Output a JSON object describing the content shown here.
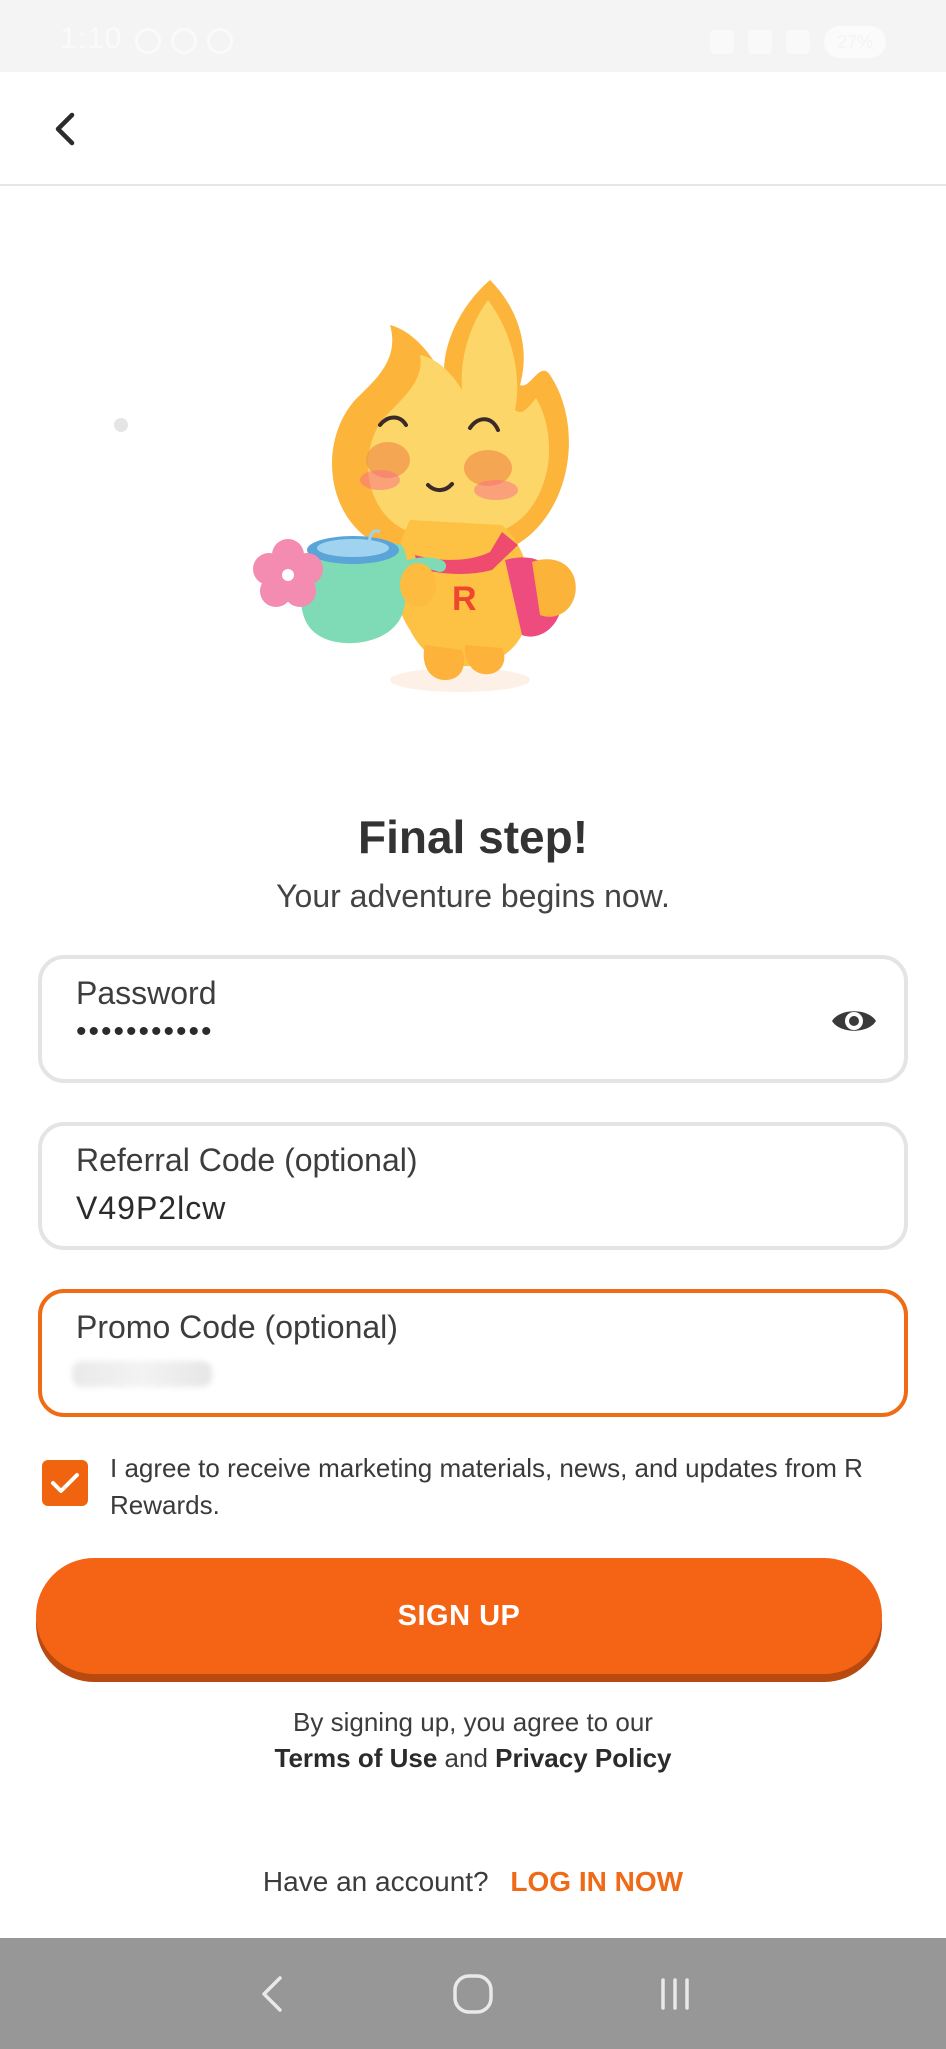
{
  "status_bar": {
    "time": "1:10",
    "battery": "27%"
  },
  "header": {
    "back_icon": "chevron-left-icon"
  },
  "main": {
    "title": "Final step!",
    "subtitle": "Your adventure begins now."
  },
  "form": {
    "password": {
      "label": "Password",
      "value": "•••••••••••",
      "toggle_icon": "eye-icon"
    },
    "referral": {
      "label": "Referral Code (optional)",
      "value": "V49P2lcw"
    },
    "promo": {
      "label": "Promo Code (optional)"
    }
  },
  "consent": {
    "checked": true,
    "text": "I agree to receive marketing materials, news, and updates from R Rewards."
  },
  "signup": {
    "label": "SIGN UP"
  },
  "terms": {
    "prefix": "By signing up, you agree to our",
    "terms_link": "Terms of Use",
    "and": "and",
    "privacy_link": "Privacy Policy"
  },
  "login": {
    "prompt": "Have an account?",
    "link": "LOG IN NOW"
  },
  "colors": {
    "accent": "#F56315",
    "button_shadow": "#B84A10",
    "nav_bar": "#979797"
  }
}
